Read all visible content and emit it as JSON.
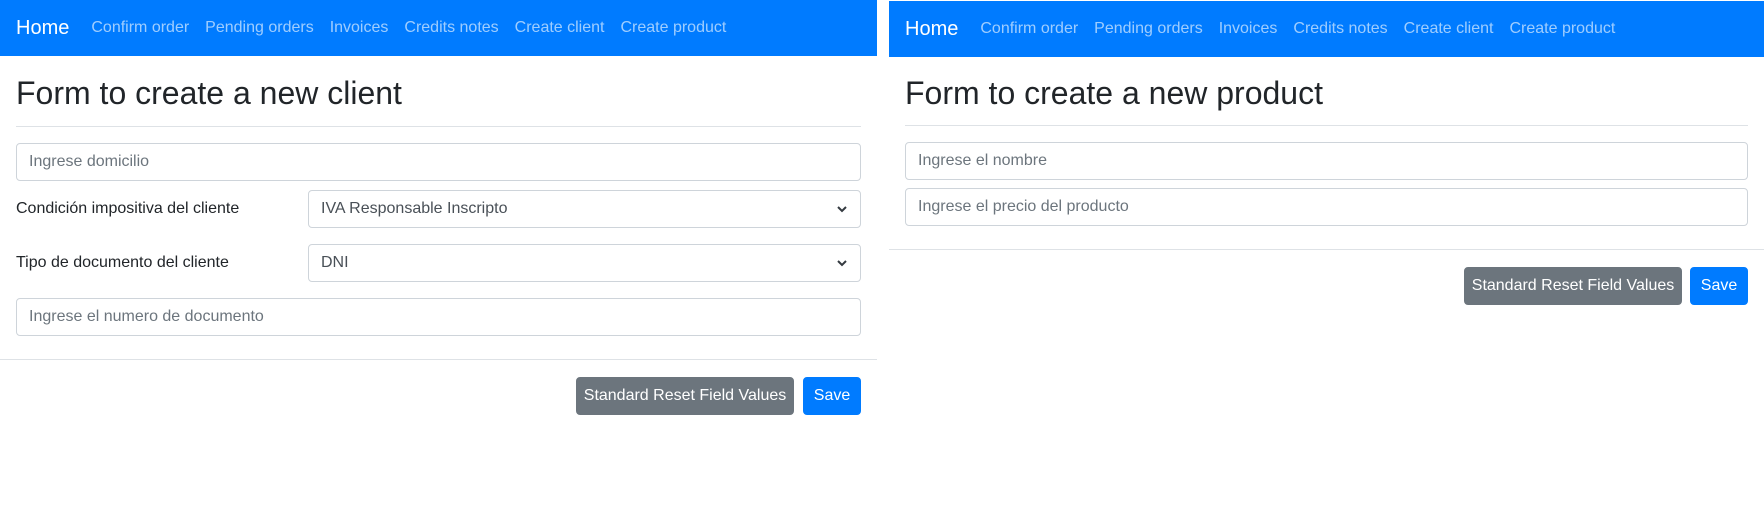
{
  "client_panel": {
    "navbar": {
      "brand": "Home",
      "links": [
        "Confirm order",
        "Pending orders",
        "Invoices",
        "Credits notes",
        "Create client",
        "Create product"
      ]
    },
    "title": "Form to create a new client",
    "address_input": {
      "placeholder": "Ingrese domicilio",
      "value": ""
    },
    "tax_condition": {
      "label": "Condición impositiva del cliente",
      "selected": "IVA Responsable Inscripto"
    },
    "document_type": {
      "label": "Tipo de documento del cliente",
      "selected": "DNI"
    },
    "document_number_input": {
      "placeholder": "Ingrese el numero de documento",
      "value": ""
    },
    "reset_label": "Standard Reset Field Values",
    "save_label": "Save"
  },
  "product_panel": {
    "navbar": {
      "brand": "Home",
      "links": [
        "Confirm order",
        "Pending orders",
        "Invoices",
        "Credits notes",
        "Create client",
        "Create product"
      ]
    },
    "title": "Form to create a new product",
    "name_input": {
      "placeholder": "Ingrese el nombre",
      "value": ""
    },
    "price_input": {
      "placeholder": "Ingrese el precio del producto",
      "value": ""
    },
    "reset_label": "Standard Reset Field Values",
    "save_label": "Save"
  },
  "colors": {
    "navbar": "#007bff",
    "primary_button": "#007bff",
    "secondary_button": "#6c757d"
  }
}
